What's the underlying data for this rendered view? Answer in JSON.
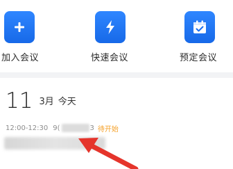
{
  "quick_actions": [
    {
      "label": "加入会议",
      "icon": "plus-icon"
    },
    {
      "label": "快速会议",
      "icon": "lightning-icon"
    },
    {
      "label": "预定会议",
      "icon": "calendar-check-icon"
    }
  ],
  "accent_color": "#1a6ef0",
  "date_header": {
    "day": "11",
    "month": "3月",
    "today": "今天"
  },
  "meeting": {
    "time": "12:00-12:30",
    "id_prefix": "9(",
    "id_suffix": "3",
    "status": "待开始",
    "status_color": "#f5a22b"
  },
  "annotation_arrow_color": "#e5342b"
}
